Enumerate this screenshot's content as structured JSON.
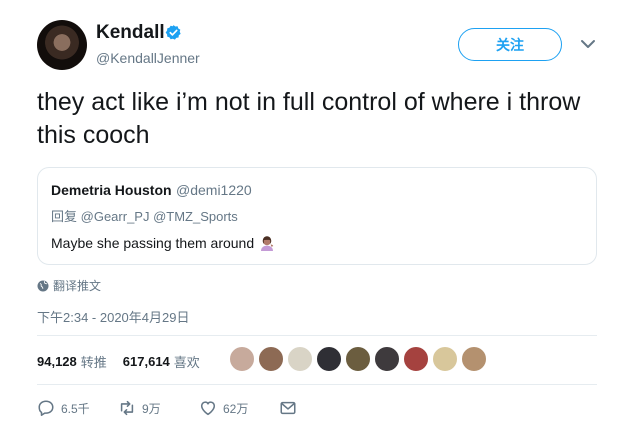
{
  "author": {
    "name": "Kendall",
    "handle": "@KendallJenner",
    "follow_label": "关注"
  },
  "tweet": {
    "text": "they act like i’m not in full control of where i throw this cooch"
  },
  "quoted": {
    "name": "Demetria Houston",
    "handle": "@demi1220",
    "reply_prefix": "回复",
    "reply_to": "@Gearr_PJ @TMZ_Sports",
    "text": "Maybe she passing them around",
    "emoji": "woman-tipping-hand-emoji"
  },
  "translate_label": "翻译推文",
  "timestamp": "下午2:34 - 2020年4月29日",
  "stats": {
    "retweets_count": "94,128",
    "retweets_label": "转推",
    "likes_count": "617,614",
    "likes_label": "喜欢"
  },
  "actions": {
    "reply_count": "6.5千",
    "retweet_count": "9万",
    "like_count": "62万"
  },
  "colors": {
    "accent": "#1da1f2",
    "secondary_text": "#657786",
    "border": "#e1e8ed"
  },
  "icons": [
    "verified-badge-icon",
    "chevron-down-icon",
    "globe-icon",
    "reply-icon",
    "retweet-icon",
    "like-icon",
    "message-icon"
  ]
}
